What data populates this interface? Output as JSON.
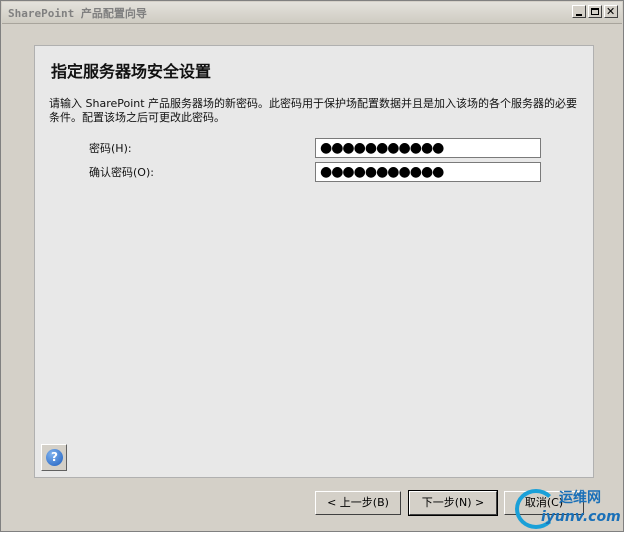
{
  "window": {
    "title": "SharePoint 产品配置向导",
    "controls": {
      "minimize_icon": "minimize-icon",
      "maximize_icon": "maximize-icon",
      "close_icon": "close-icon"
    }
  },
  "page": {
    "heading": "指定服务器场安全设置",
    "description": "请输入 SharePoint 产品服务器场的新密码。此密码用于保护场配置数据并且是加入该场的各个服务器的必要条件。配置该场之后可更改此密码。"
  },
  "form": {
    "password_label": "密码(H):",
    "password_value": "●●●●●●●●●●●",
    "confirm_label": "确认密码(O):",
    "confirm_value": "●●●●●●●●●●●"
  },
  "help": {
    "glyph": "?",
    "icon": "help-icon"
  },
  "buttons": {
    "prev": "< 上一步(B)",
    "next": "下一步(N) >",
    "cancel": "取消(C)"
  },
  "watermark": {
    "top": "运维网",
    "bottom": "iyunv.com"
  },
  "colors": {
    "window_bg": "#d4d0c8",
    "panel_bg": "#e8e8e8",
    "help_blue": "#1f5fbf",
    "watermark": "#1a70b8"
  }
}
